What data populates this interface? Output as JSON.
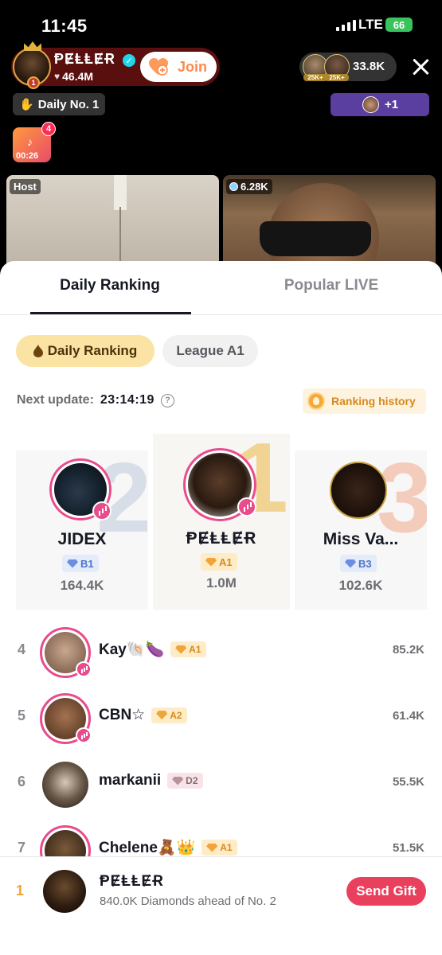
{
  "status_bar": {
    "time": "11:45",
    "network": "LTE",
    "battery": "66"
  },
  "live": {
    "host_name": "ⱣɆⱠⱠɆɌ",
    "host_likes": "46.4M",
    "join_label": "Join",
    "viewer_badges": [
      "25K+",
      "25K+"
    ],
    "viewer_count": "33.8K",
    "daily_no": "Daily No. 1",
    "plus_label": "+1",
    "gift_badge": "4",
    "gift_timer": "00:26",
    "host_tag": "Host",
    "guest_count": "6.28K"
  },
  "sheet": {
    "tabs": [
      {
        "label": "Daily Ranking"
      },
      {
        "label": "Popular LIVE"
      }
    ],
    "chips": [
      {
        "label": "Daily Ranking"
      },
      {
        "label": "League A1"
      }
    ],
    "next_update_label": "Next update:",
    "next_update_value": "23:14:19",
    "history_label": "Ranking history"
  },
  "podium": [
    {
      "place": "2",
      "name": "JIDEX",
      "league": "B1",
      "score": "164.4K"
    },
    {
      "place": "1",
      "name": "ⱣɆⱠⱠɆɌ",
      "league": "A1",
      "score": "1.0M"
    },
    {
      "place": "3",
      "name": "Miss Va...",
      "league": "B3",
      "score": "102.6K"
    }
  ],
  "list": [
    {
      "rank": "4",
      "name": "Kay🐚🍆",
      "league": "A1",
      "score": "85.2K"
    },
    {
      "rank": "5",
      "name": "CBN☆",
      "league": "A2",
      "score": "61.4K"
    },
    {
      "rank": "6",
      "name": "markanii",
      "league": "D2",
      "score": "55.5K"
    },
    {
      "rank": "7",
      "name": "Chelene🧸👑",
      "league": "A1",
      "score": "51.5K"
    }
  ],
  "bottom": {
    "rank": "1",
    "name": "ⱣɆⱠⱠɆɌ",
    "subtitle": "840.0K Diamonds ahead of No. 2",
    "send_gift_label": "Send Gift"
  },
  "colors": {
    "accent": "#e9405e",
    "live_ring": "#e84c8d",
    "gold": "#f0a43a"
  },
  "icons": [
    "heart-icon",
    "verified-icon",
    "close-icon",
    "flame-icon",
    "help-icon",
    "medal-icon",
    "diamond-icon",
    "live-bars-icon"
  ]
}
